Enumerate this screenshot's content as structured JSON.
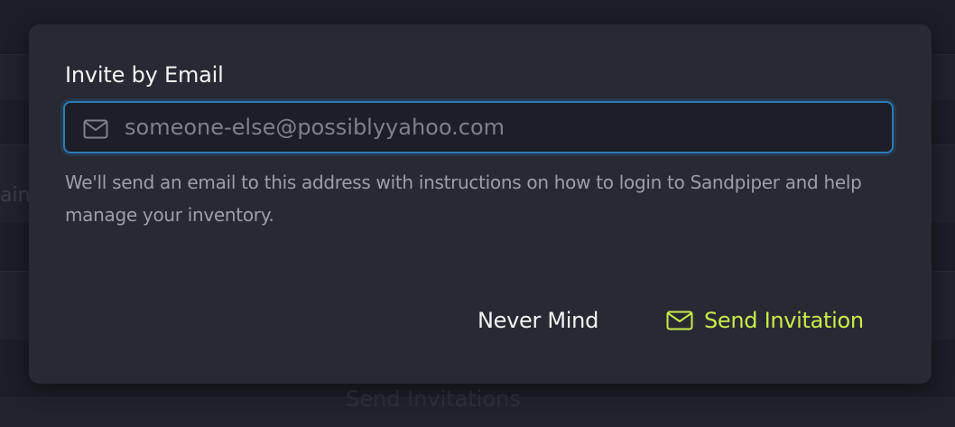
{
  "background": {
    "partial_left_text": "ain",
    "partial_bottom_text": "Send Invitations"
  },
  "modal": {
    "field_label": "Invite by Email",
    "email_input": {
      "value": "",
      "placeholder": "someone-else@possiblyyahoo.com",
      "icon": "envelope-icon"
    },
    "help_text": "We'll send an email to this address with instructions on how to login to Sandpiper and help manage your inventory.",
    "buttons": {
      "cancel_label": "Never Mind",
      "send_label": "Send Invitation",
      "send_icon": "envelope-icon"
    }
  },
  "colors": {
    "background": "#1b1e26",
    "modal": "#272a33",
    "input_border": "#2d7ab5",
    "accent": "#c9ec4b",
    "text_primary": "#f2f3f5",
    "text_muted": "#9b9fa8"
  }
}
